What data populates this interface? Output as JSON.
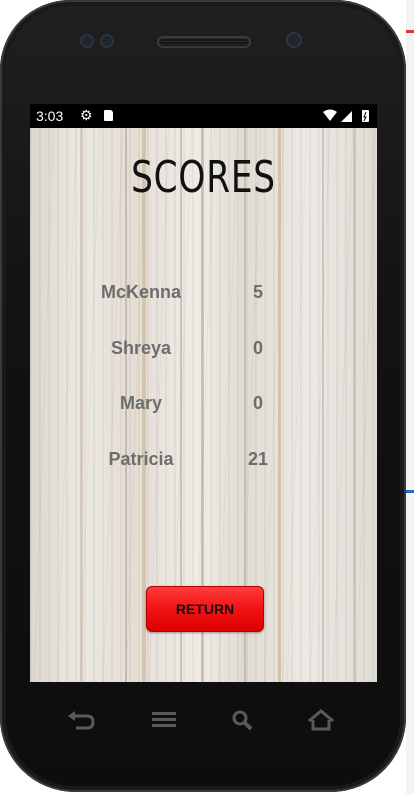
{
  "status_bar": {
    "time": "3:03",
    "icons": [
      "settings-gear-icon",
      "sd-card-icon",
      "wifi-icon",
      "cell-signal-icon",
      "battery-icon"
    ]
  },
  "screen": {
    "title": "SCORES",
    "scores": [
      {
        "name": "McKenna",
        "score": "5"
      },
      {
        "name": "Shreya",
        "score": "0"
      },
      {
        "name": "Mary",
        "score": "0"
      },
      {
        "name": "Patricia",
        "score": "21"
      }
    ],
    "return_label": "RETURN"
  },
  "nav_buttons": [
    "back-icon",
    "recent-apps-icon",
    "search-icon",
    "home-icon"
  ],
  "colors": {
    "button_red": "#f21313",
    "text_gray": "#6d6d6d",
    "title_black": "#111111",
    "phone_body": "#121212"
  }
}
